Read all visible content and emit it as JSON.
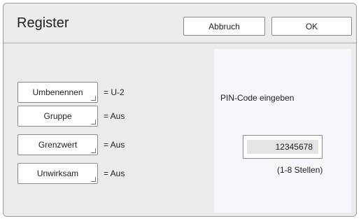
{
  "dialog": {
    "title": "Register",
    "cancel_label": "Abbruch",
    "ok_label": "OK"
  },
  "settings": [
    {
      "label": "Umbenennen",
      "value": "= U-2"
    },
    {
      "label": "Gruppe",
      "value": "= Aus"
    },
    {
      "label": "Grenzwert",
      "value": "= Aus"
    },
    {
      "label": "Unwirksam",
      "value": "= Aus"
    }
  ],
  "pin": {
    "label": "PIN-Code eingeben",
    "value": "12345678",
    "hint": "(1-8 Stellen)"
  },
  "colors": {
    "background": "#ebebeb",
    "panel": "#f5f6fa",
    "button": "#ffffff",
    "border": "#8c8c8c",
    "field_fill": "#e4e4e4"
  }
}
